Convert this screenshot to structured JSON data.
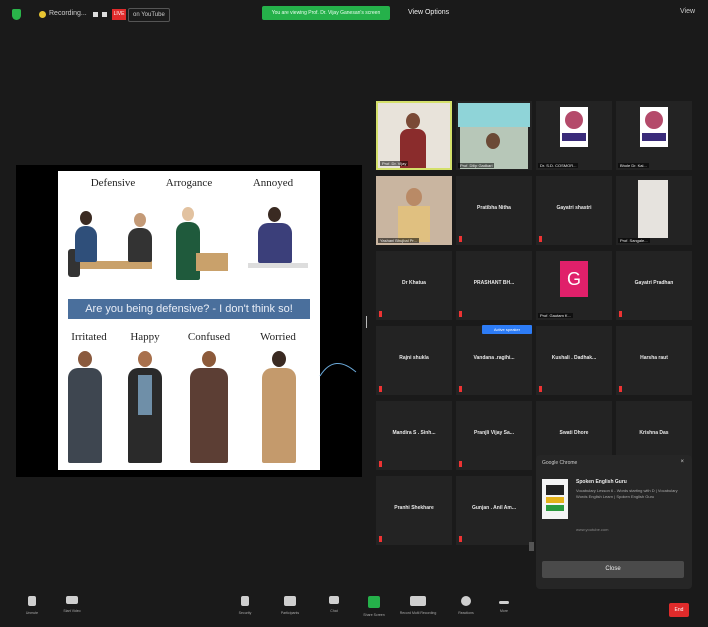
{
  "topbar": {
    "recording_label": "Recording...",
    "live_badge": "LIVE",
    "live_destination": "on YouTube",
    "share_banner": "You are viewing Prof. Dr. Vijay Ganesan's screen",
    "view_options": "View Options",
    "view_button": "View"
  },
  "slide": {
    "top_labels": [
      "Defensive",
      "Arrogance",
      "Annoyed"
    ],
    "banner": "Are you being defensive? - I don't think so!",
    "bottom_labels": [
      "Irritated",
      "Happy",
      "Confused",
      "Worried"
    ]
  },
  "participants": [
    {
      "name": "Prof. Dr. Vijay",
      "type": "video"
    },
    {
      "name": "Prof. Dilip Gadkari",
      "type": "video"
    },
    {
      "name": "Dr. S.D. COSMOR...",
      "type": "logo"
    },
    {
      "name": "Bhole Dr. Kal...",
      "type": "logo"
    },
    {
      "name": "Yashani Bhujbal Pr...",
      "type": "video"
    },
    {
      "name": "Pratibha Nitha",
      "type": "name"
    },
    {
      "name": "Gayatri shastri",
      "type": "name"
    },
    {
      "name": "Prof. Sangale...",
      "type": "video"
    },
    {
      "name": "Dr Khatua",
      "type": "name"
    },
    {
      "name": "PRASHANT BH...",
      "type": "name"
    },
    {
      "name": "Prof. Gautam K...",
      "type": "avatar",
      "initial": "G"
    },
    {
      "name": "Gayatri Pradhan",
      "type": "name"
    },
    {
      "name": "Rajni shukla",
      "type": "name"
    },
    {
      "name": "Vandana .ragihi...",
      "type": "name"
    },
    {
      "name": "Kushali . Dadhak...",
      "type": "name"
    },
    {
      "name": "Harsha raut",
      "type": "name"
    },
    {
      "name": "Mandira S . Sinh...",
      "type": "name"
    },
    {
      "name": "Pranjli Vijay Sa...",
      "type": "name"
    },
    {
      "name": "Swati Dhore",
      "type": "name"
    },
    {
      "name": "Krishna Das",
      "type": "name"
    },
    {
      "name": "Pranhi Shekhare",
      "type": "name"
    },
    {
      "name": "Gunjan . Anil Am...",
      "type": "name"
    }
  ],
  "speaking_badge": "Active speaker",
  "notification": {
    "source": "Google Chrome",
    "title": "Spoken English Guru",
    "description": "Vocabulary Lesson 6 - Words starting with D | Vocabulary Words English Learn | Spoken English Guru",
    "url": "www.youtube.com",
    "close_button": "Close"
  },
  "toolbar": [
    {
      "label": "Unmute",
      "icon": "microphone-icon"
    },
    {
      "label": "Start Video",
      "icon": "video-camera-icon"
    },
    {
      "label": "Security",
      "icon": "shield-icon"
    },
    {
      "label": "Participants",
      "icon": "participants-icon"
    },
    {
      "label": "Chat",
      "icon": "chat-icon"
    },
    {
      "label": "Share Screen",
      "icon": "share-screen-icon"
    },
    {
      "label": "Record Multi Recording",
      "icon": "record-icon"
    },
    {
      "label": "Reactions",
      "icon": "smile-icon"
    },
    {
      "label": "More",
      "icon": "more-icon"
    }
  ],
  "end_button": "End",
  "colors": {
    "background": "#1a1a1a",
    "share_banner": "#25b14a",
    "live_badge": "#e02b2b",
    "active_speaker_border": "#d4e06a",
    "avatar_pink": "#e0206a",
    "slide_banner": "#4a6f9c"
  }
}
